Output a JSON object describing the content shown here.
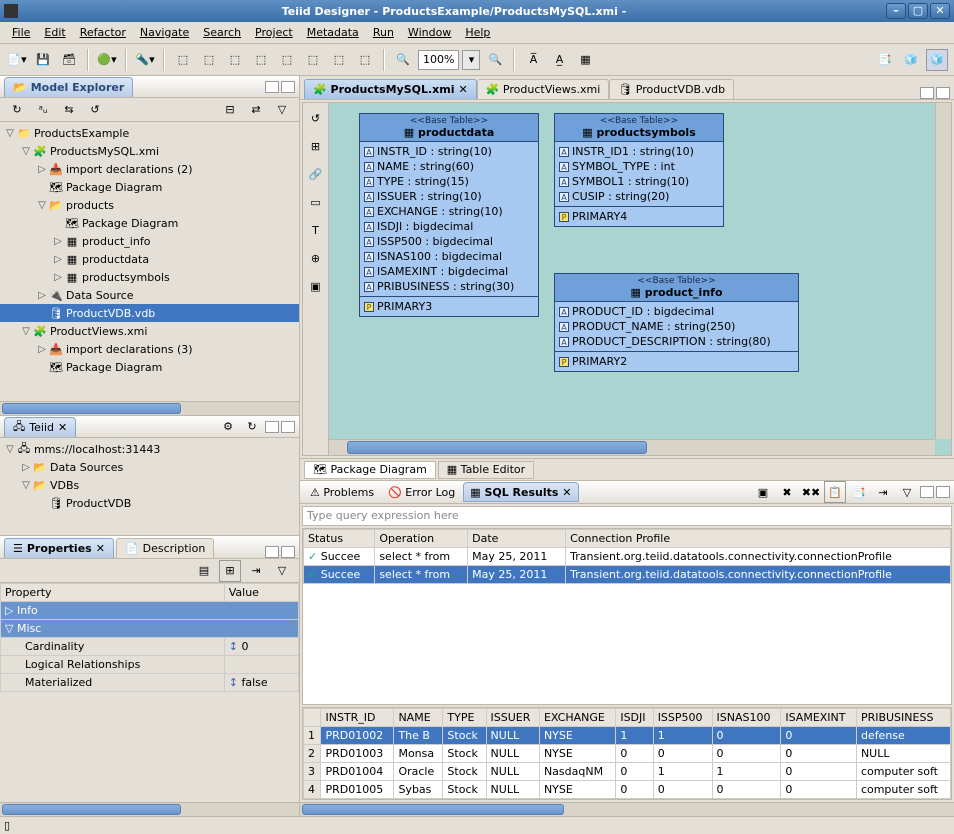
{
  "window": {
    "title": "Teiid Designer - ProductsExample/ProductsMySQL.xmi -"
  },
  "menu": [
    "File",
    "Edit",
    "Refactor",
    "Navigate",
    "Search",
    "Project",
    "Metadata",
    "Run",
    "Window",
    "Help"
  ],
  "zoom": "100%",
  "modelExplorer": {
    "title": "Model Explorer",
    "tree": [
      {
        "d": 0,
        "tw": "▽",
        "ic": "📁",
        "l": "ProductsExample"
      },
      {
        "d": 1,
        "tw": "▽",
        "ic": "🧩",
        "l": "ProductsMySQL.xmi"
      },
      {
        "d": 2,
        "tw": "▷",
        "ic": "📥",
        "l": "import declarations (2)"
      },
      {
        "d": 2,
        "tw": "",
        "ic": "🗺",
        "l": "Package Diagram"
      },
      {
        "d": 2,
        "tw": "▽",
        "ic": "📂",
        "l": "products"
      },
      {
        "d": 3,
        "tw": "",
        "ic": "🗺",
        "l": "Package Diagram"
      },
      {
        "d": 3,
        "tw": "▷",
        "ic": "▦",
        "l": "product_info"
      },
      {
        "d": 3,
        "tw": "▷",
        "ic": "▦",
        "l": "productdata"
      },
      {
        "d": 3,
        "tw": "▷",
        "ic": "▦",
        "l": "productsymbols"
      },
      {
        "d": 2,
        "tw": "▷",
        "ic": "🔌",
        "l": "Data Source"
      },
      {
        "d": 2,
        "tw": "",
        "ic": "🛢",
        "l": "ProductVDB.vdb",
        "sel": true
      },
      {
        "d": 1,
        "tw": "▽",
        "ic": "🧩",
        "l": "ProductViews.xmi"
      },
      {
        "d": 2,
        "tw": "▷",
        "ic": "📥",
        "l": "import declarations (3)"
      },
      {
        "d": 2,
        "tw": "",
        "ic": "🗺",
        "l": "Package Diagram"
      }
    ]
  },
  "teiidView": {
    "title": "Teiid",
    "tree": [
      {
        "d": 0,
        "tw": "▽",
        "ic": "🖧",
        "l": "mms://localhost:31443"
      },
      {
        "d": 1,
        "tw": "▷",
        "ic": "📂",
        "l": "Data Sources"
      },
      {
        "d": 1,
        "tw": "▽",
        "ic": "📂",
        "l": "VDBs"
      },
      {
        "d": 2,
        "tw": "",
        "ic": "🛢",
        "l": "ProductVDB"
      }
    ]
  },
  "properties": {
    "title": "Properties",
    "descTab": "Description",
    "cols": {
      "p": "Property",
      "v": "Value"
    },
    "rows": [
      {
        "grp": true,
        "tw": "▷",
        "l": "Info"
      },
      {
        "grp": true,
        "tw": "▽",
        "l": "Misc"
      },
      {
        "p": "Cardinality",
        "v": "0",
        "ic": "↕"
      },
      {
        "p": "Logical Relationships",
        "v": ""
      },
      {
        "p": "Materialized",
        "v": "false",
        "ic": "↕"
      }
    ]
  },
  "editorTabs": [
    {
      "ic": "🧩",
      "l": "ProductsMySQL.xmi",
      "a": true,
      "x": true
    },
    {
      "ic": "🧩",
      "l": "ProductViews.xmi"
    },
    {
      "ic": "🛢",
      "l": "ProductVDB.vdb"
    }
  ],
  "diagram": {
    "bottomTabs": [
      {
        "ic": "🗺",
        "l": "Package Diagram",
        "a": true
      },
      {
        "ic": "▦",
        "l": "Table Editor"
      }
    ],
    "ent1": {
      "st": "<<Base Table>>",
      "nm": "productdata",
      "cols": [
        "INSTR_ID : string(10)",
        "NAME : string(60)",
        "TYPE : string(15)",
        "ISSUER : string(10)",
        "EXCHANGE : string(10)",
        "ISDJI : bigdecimal",
        "ISSP500 : bigdecimal",
        "ISNAS100 : bigdecimal",
        "ISAMEXINT : bigdecimal",
        "PRIBUSINESS : string(30)"
      ],
      "pk": "PRIMARY3"
    },
    "ent2": {
      "st": "<<Base Table>>",
      "nm": "productsymbols",
      "cols": [
        "INSTR_ID1 : string(10)",
        "SYMBOL_TYPE : int",
        "SYMBOL1 : string(10)",
        "CUSIP : string(20)"
      ],
      "pk": "PRIMARY4"
    },
    "ent3": {
      "st": "<<Base Table>>",
      "nm": "product_info",
      "cols": [
        "PRODUCT_ID : bigdecimal",
        "PRODUCT_NAME : string(250)",
        "PRODUCT_DESCRIPTION : string(80)"
      ],
      "pk": "PRIMARY2"
    }
  },
  "bottomViews": {
    "tabs": [
      {
        "l": "Problems",
        "ic": "⚠"
      },
      {
        "l": "Error Log",
        "ic": "🚫"
      },
      {
        "l": "SQL Results",
        "ic": "▦",
        "a": true,
        "x": true
      }
    ],
    "query_placeholder": "Type query expression here",
    "hist_cols": [
      "Status",
      "Operation",
      "Date",
      "Connection Profile"
    ],
    "hist": [
      {
        "s": "✓",
        "st": "Succee",
        "op": "select * from",
        "dt": "May 25, 2011",
        "cp": "Transient.org.teiid.datatools.connectivity.connectionProfile"
      },
      {
        "s": "✓",
        "st": "Succee",
        "op": "select * from",
        "dt": "May 25, 2011",
        "cp": "Transient.org.teiid.datatools.connectivity.connectionProfile",
        "sel": true
      }
    ],
    "res_cols": [
      "",
      "INSTR_ID",
      "NAME",
      "TYPE",
      "ISSUER",
      "EXCHANGE",
      "ISDJI",
      "ISSP500",
      "ISNAS100",
      "ISAMEXINT",
      "PRIBUSINESS"
    ],
    "res": [
      {
        "n": "1",
        "c": [
          "PRD01002",
          "The B",
          "Stock",
          "NULL",
          "NYSE",
          "1",
          "1",
          "0",
          "0",
          "defense"
        ],
        "sel": true
      },
      {
        "n": "2",
        "c": [
          "PRD01003",
          "Monsa",
          "Stock",
          "NULL",
          "NYSE",
          "0",
          "0",
          "0",
          "0",
          "NULL"
        ]
      },
      {
        "n": "3",
        "c": [
          "PRD01004",
          "Oracle",
          "Stock",
          "NULL",
          "NasdaqNM",
          "0",
          "1",
          "1",
          "0",
          "computer soft"
        ]
      },
      {
        "n": "4",
        "c": [
          "PRD01005",
          "Sybas",
          "Stock",
          "NULL",
          "NYSE",
          "0",
          "0",
          "0",
          "0",
          "computer soft"
        ]
      }
    ]
  }
}
